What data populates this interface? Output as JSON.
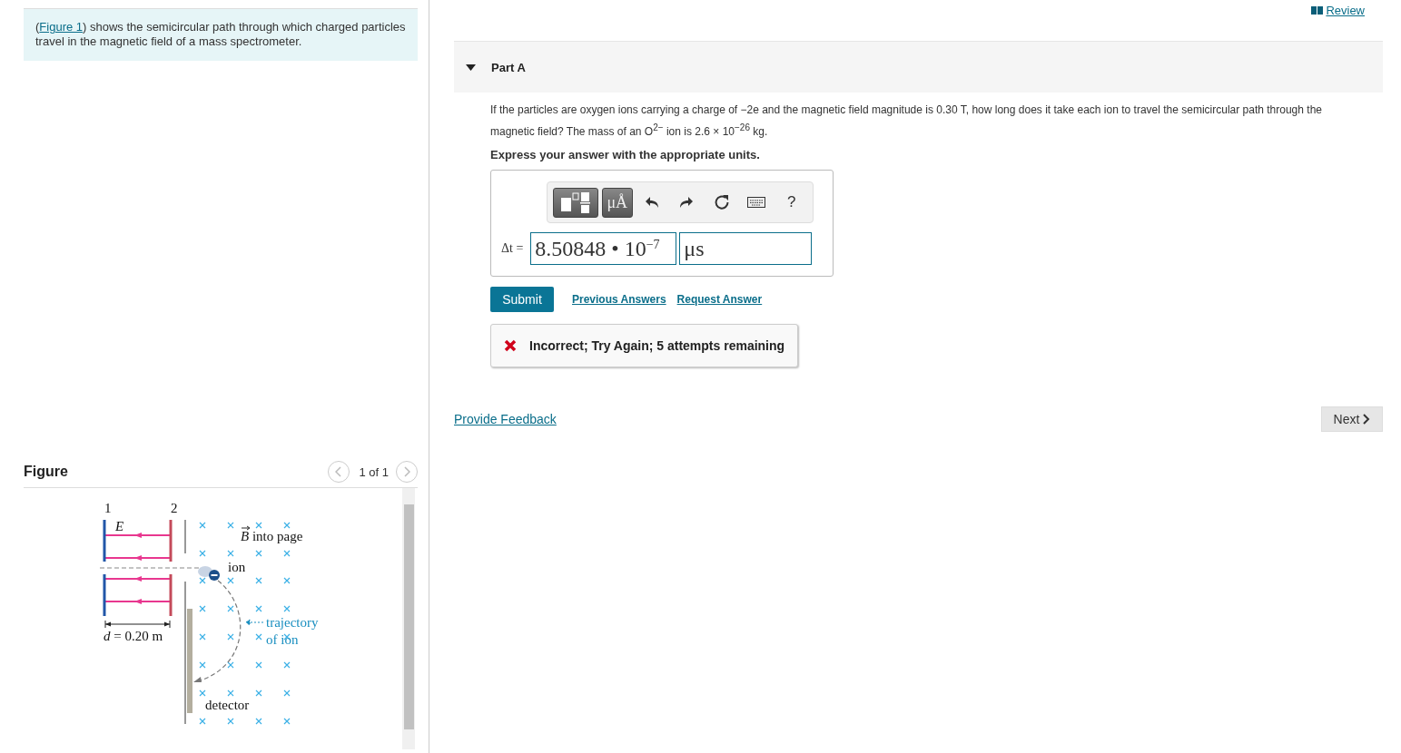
{
  "intro": {
    "prefix": "(",
    "link": "Figure 1",
    "suffix": ") shows the semicircular path through which charged particles travel in the magnetic field of a mass spectrometer."
  },
  "figure": {
    "title": "Figure",
    "pager": "1 of 1",
    "labels": [
      {
        "kind": "black",
        "text": "1"
      },
      {
        "kind": "black",
        "text": "2"
      },
      {
        "kind": "black",
        "text": "*E*"
      },
      {
        "kind": "black",
        "text": "*B* into page"
      },
      {
        "kind": "black",
        "text": "ion"
      },
      {
        "kind": "blue",
        "text": "trajectory"
      },
      {
        "kind": "blue",
        "text": "of ion"
      },
      {
        "kind": "black",
        "text": "*d* = 0.20 m"
      },
      {
        "kind": "black",
        "text": "detector"
      }
    ]
  },
  "review": "Review",
  "part": {
    "title": "Part A",
    "expanded": true,
    "question": "If the particles are oxygen ions carrying a charge of −2e and the magnetic field magnitude is 0.30 T, how long does it take each ion to travel the semicircular path through the magnetic field? The mass of an O$^{2−}$ ion is 2.6 × 10$^{−26}$ kg.",
    "instruction": "Express your answer with the appropriate units.",
    "toolbar": {
      "units": "μÅ",
      "help": "?"
    },
    "answer_label": "Δt =",
    "value": "8.50848 • 10$^{−7}$",
    "unit": "μs",
    "submit": "Submit",
    "links": [
      "Previous Answers",
      "Request Answer"
    ],
    "feedback": {
      "kind": "incorrect",
      "text": "Incorrect; Try Again; 5 attempts remaining"
    }
  },
  "provide_feedback": "Provide Feedback",
  "next": "Next"
}
